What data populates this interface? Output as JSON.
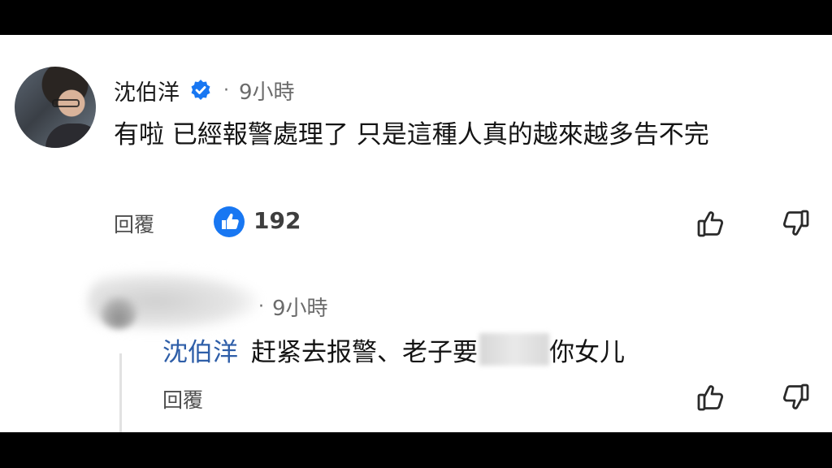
{
  "comment": {
    "author": "沈伯洋",
    "verified": true,
    "separator": "·",
    "time": "9小時",
    "text": "有啦 已經報警處理了 只是這種人真的越來越多告不完",
    "reply_label": "回覆",
    "like_count": "192"
  },
  "reply": {
    "separator": "·",
    "time": "9小時",
    "mention": "沈伯洋",
    "text_before": "赶紧去报警、老子要",
    "text_after": "你女儿",
    "reply_label": "回覆"
  },
  "colors": {
    "verified_blue": "#1877f2",
    "like_blue": "#1877f2",
    "mention_blue": "#2e5ea8"
  },
  "icons": {
    "verified": "verified-badge-icon",
    "like_badge": "like-badge-icon",
    "thumbs_up": "thumbs-up-icon",
    "thumbs_down": "thumbs-down-icon"
  }
}
